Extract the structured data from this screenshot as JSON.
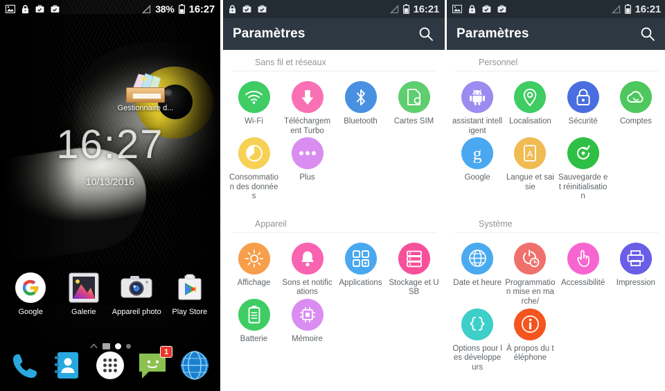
{
  "home": {
    "statusbar": {
      "icons": [
        "image-icon",
        "lock-icon",
        "briefcase-check-icon",
        "briefcase-check-icon"
      ],
      "signal_icon": "no-signal-icon",
      "battery_percent": "38%",
      "time": "16:27"
    },
    "clock_widget": {
      "time": "16:27",
      "date": "10/13/2016"
    },
    "widget": {
      "label": "Gestionnaire d...",
      "icon": "file-manager-box-icon"
    },
    "apps": [
      {
        "label": "Google",
        "icon": "google-g-icon"
      },
      {
        "label": "Galerie",
        "icon": "gallery-icon"
      },
      {
        "label": "Appareil photo",
        "icon": "camera-icon"
      },
      {
        "label": "Play Store",
        "icon": "play-store-icon"
      }
    ],
    "dock": [
      {
        "label": "Téléphone",
        "icon": "phone-icon",
        "badge": ""
      },
      {
        "label": "Contacts",
        "icon": "contacts-icon",
        "badge": ""
      },
      {
        "label": "Applications",
        "icon": "app-drawer-icon",
        "badge": ""
      },
      {
        "label": "Messagerie",
        "icon": "messaging-icon",
        "badge": "1"
      },
      {
        "label": "Navigateur",
        "icon": "browser-icon",
        "badge": ""
      }
    ],
    "page_indicator": {
      "pages": 4,
      "active_index": 2
    }
  },
  "settings_left": {
    "statusbar": {
      "icons": [
        "lock-icon",
        "briefcase-check-icon",
        "briefcase-check-icon"
      ],
      "signal_icon": "no-signal-icon",
      "time": "16:21"
    },
    "appbar": {
      "title": "Paramètres",
      "search_icon": "search-icon"
    },
    "sections": [
      {
        "title": "Sans fil et réseaux",
        "items": [
          {
            "label": "Wi-Fi",
            "icon": "wifi-icon",
            "color": "#3ecc63"
          },
          {
            "label": "Téléchargement Turbo",
            "icon": "download-arrow-icon",
            "color": "#f971b4"
          },
          {
            "label": "Bluetooth",
            "icon": "bluetooth-icon",
            "color": "#4a90e2"
          },
          {
            "label": "Cartes SIM",
            "icon": "sim-card-icon",
            "color": "#5ece6f"
          },
          {
            "label": "Consommation des données",
            "icon": "data-usage-pie-icon",
            "color": "#f7d154"
          },
          {
            "label": "Plus",
            "icon": "more-dots-icon",
            "color": "#d98df0"
          }
        ]
      },
      {
        "title": "Appareil",
        "items": [
          {
            "label": "Affichage",
            "icon": "brightness-sun-icon",
            "color": "#f79e4a"
          },
          {
            "label": "Sons et notifications",
            "icon": "bell-icon",
            "color": "#f963b0"
          },
          {
            "label": "Applications",
            "icon": "apps-grid-icon",
            "color": "#4aa8f0"
          },
          {
            "label": "Stockage et USB",
            "icon": "storage-icon",
            "color": "#f7509b"
          },
          {
            "label": "Batterie",
            "icon": "battery-icon",
            "color": "#3ecc63"
          },
          {
            "label": "Mémoire",
            "icon": "memory-chip-icon",
            "color": "#d98df0"
          }
        ]
      }
    ]
  },
  "settings_right": {
    "statusbar": {
      "icons": [
        "image-icon",
        "lock-icon",
        "briefcase-check-icon",
        "briefcase-check-icon"
      ],
      "signal_icon": "no-signal-icon",
      "time": "16:21"
    },
    "appbar": {
      "title": "Paramètres",
      "search_icon": "search-icon"
    },
    "sections": [
      {
        "title": "Personnel",
        "items": [
          {
            "label": "assistant intelligent",
            "icon": "android-robot-icon",
            "color": "#9b8cf0"
          },
          {
            "label": "Localisation",
            "icon": "location-pin-icon",
            "color": "#3ecc63"
          },
          {
            "label": "Sécurité",
            "icon": "lock-icon",
            "color": "#4a6ee0"
          },
          {
            "label": "Comptes",
            "icon": "cloud-sync-icon",
            "color": "#4ec85e"
          },
          {
            "label": "Google",
            "icon": "google-g-icon",
            "color": "#4aa8f0"
          },
          {
            "label": "Langue et saisie",
            "icon": "language-a-icon",
            "color": "#f0bb52"
          },
          {
            "label": "Sauvegarde et réinitialisation",
            "icon": "backup-reset-icon",
            "color": "#2fbf44"
          }
        ]
      },
      {
        "title": "Système",
        "items": [
          {
            "label": "Date et heure",
            "icon": "globe-icon",
            "color": "#4aaaf0"
          },
          {
            "label": "Programmation mise en marche/",
            "icon": "power-schedule-icon",
            "color": "#f0706b"
          },
          {
            "label": "Accessibilité",
            "icon": "hand-pointer-icon",
            "color": "#f765d0"
          },
          {
            "label": "Impression",
            "icon": "printer-icon",
            "color": "#6a5ee8"
          },
          {
            "label": "Options pour les développeurs",
            "icon": "braces-code-icon",
            "color": "#3ecfc8"
          },
          {
            "label": "À propos du téléphone",
            "icon": "info-circle-icon",
            "color": "#f4551f"
          }
        ]
      }
    ]
  }
}
